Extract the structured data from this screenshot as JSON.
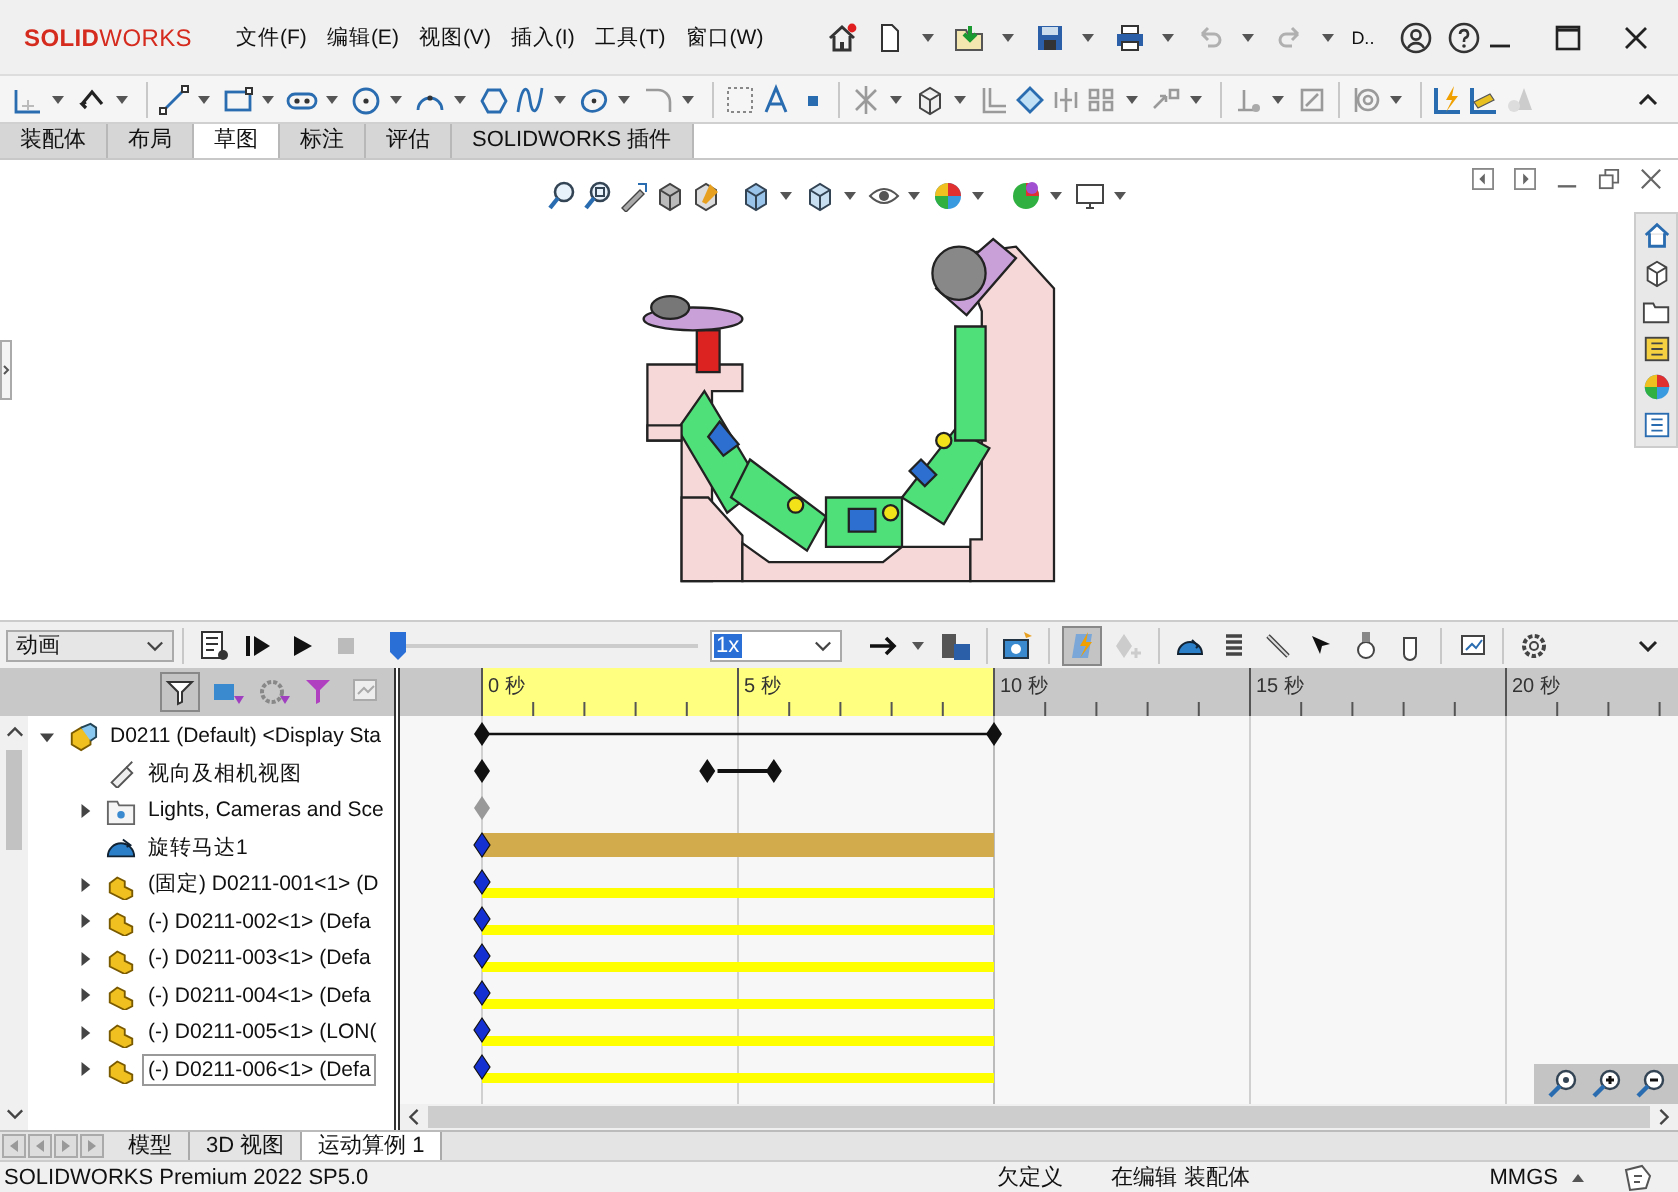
{
  "title_bar": {
    "logo": "**SOLID**WORKS",
    "menus": [
      "文件(F)",
      "编辑(E)",
      "视图(V)",
      "插入(I)",
      "工具(T)",
      "窗口(W)"
    ],
    "quick_label": "D.."
  },
  "command_tabs": [
    {
      "label": "装配体",
      "selected": false
    },
    {
      "label": "布局",
      "selected": false
    },
    {
      "label": "草图",
      "selected": true
    },
    {
      "label": "标注",
      "selected": false
    },
    {
      "label": "评估",
      "selected": false
    },
    {
      "label": "SOLIDWORKS 插件",
      "selected": false
    }
  ],
  "motion_manager": {
    "study_type": "动画",
    "time_slider": {
      "level": 0
    },
    "playback_speed": "1x",
    "time_ticks": [
      "0 秒",
      "5 秒",
      "10 秒",
      "15 秒",
      "20 秒"
    ],
    "tree": [
      {
        "label": "D0211 (Default) <Display Sta",
        "kind": "assembly",
        "expanded": true,
        "selected": false,
        "children": [
          {
            "label": "视向及相机视图",
            "kind": "view",
            "selected": false
          },
          {
            "label": "Lights, Cameras and Sce",
            "kind": "lights",
            "expanded": false,
            "selected": false
          },
          {
            "label": "旋转马达1",
            "kind": "motor",
            "selected": false
          },
          {
            "label": "(固定) D0211-001<1> (D",
            "kind": "part",
            "expanded": false,
            "selected": false
          },
          {
            "label": "(-) D0211-002<1> (Defa",
            "kind": "part",
            "expanded": false,
            "selected": false
          },
          {
            "label": "(-) D0211-003<1> (Defa",
            "kind": "part",
            "expanded": false,
            "selected": false
          },
          {
            "label": "(-) D0211-004<1> (Defa",
            "kind": "part",
            "expanded": false,
            "selected": false
          },
          {
            "label": "(-) D0211-005<1> (LON(",
            "kind": "part",
            "expanded": false,
            "selected": false
          },
          {
            "label": "(-) D0211-006<1> (Defa",
            "kind": "part",
            "expanded": false,
            "selected": true
          }
        ]
      }
    ]
  },
  "bottom_tabs": [
    {
      "label": "模型",
      "selected": false
    },
    {
      "label": "3D 视图",
      "selected": false
    },
    {
      "label": "运动算例 1",
      "selected": true
    }
  ],
  "status_bar": {
    "product": "SOLIDWORKS Premium 2022 SP5.0",
    "definition": "欠定义",
    "mode": "在编辑 装配体",
    "units": "MMGS"
  }
}
